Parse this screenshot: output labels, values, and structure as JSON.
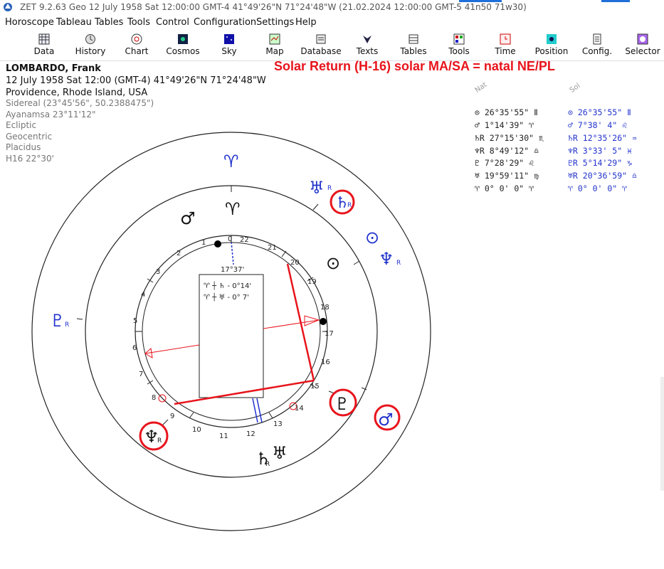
{
  "window": {
    "title": "ZET 9.2.63 Geo   12 July 1958  Sat  12:00:00 GMT-4 41°49'26\"N  71°24'48\"W  (21.02.2024  12:00:00 GMT-5 41n50 71w30)"
  },
  "menu": [
    "Horoscope",
    "Tableau",
    "Tables",
    "Tools",
    "Control",
    "Configuration",
    "Settings",
    "Help"
  ],
  "toolbar": [
    "Data",
    "History",
    "Chart",
    "Cosmos",
    "Sky",
    "Map",
    "Database",
    "Texts",
    "Tables",
    "Tools",
    "Time",
    "Position",
    "Config.",
    "Selector"
  ],
  "header": {
    "name": "LOMBARDO, Frank",
    "datetime": "12 July 1958  Sat  12:00 (GMT-4)  41°49'26\"N  71°24'48\"W",
    "place": "Providence, Rhode Island, USA"
  },
  "calc": {
    "zodiac": "Sidereal (23°45'56\", 50.2388475\")",
    "ayanamsa": "Ayanamsa 23°11'12\"",
    "coords": "Ecliptic",
    "center": "Geocentric",
    "houses": "Placidus",
    "harmonic": "H16  22°30'"
  },
  "chart_label": "Solar Return (H-16) solar MA/SA = natal NE/PL",
  "positions": {
    "natal_header": "Nat",
    "solar_header": "Sol",
    "natal": [
      "⊙   26°35'55\" Ⅱ",
      "♂    1°14'39\" ♈",
      "♄R  27°15'30\" ♏",
      "♆R   8°49'12\" ♎",
      "♇    7°28'29\" ♌",
      "♅   19°59'11\" ♍",
      "♈    0° 0' 0\" ♈"
    ],
    "solar": [
      "⊙   26°35'55\" Ⅱ",
      "♂    7°38' 4\" ♌",
      "♄R  12°35'26\" ♒",
      "♆R   3°33' 5\" ♓",
      "♇R   5°14'29\" ♑",
      "♅R  20°36'59\" ♎",
      "♈    0° 0' 0\" ♈"
    ]
  },
  "chart": {
    "inner_box": {
      "mc_degree": "17°37'",
      "aspect1": "♈ ┼ ♄ - 0°14'",
      "aspect2": "♈ ┼ ♅ - 0° 7'"
    },
    "house_numbers": [
      "22",
      "21",
      "20",
      "19",
      "18",
      "17",
      "16",
      "15",
      "14",
      "13",
      "12",
      "11",
      "10",
      "9",
      "8",
      "7",
      "6",
      "5",
      "4",
      "3",
      "2",
      "1",
      "0"
    ],
    "glyphs": {
      "aries_top": "♈",
      "aries_inner": "♈",
      "mars_natal": "♂",
      "sun_natal": "⊙",
      "pluto_natal": "♇",
      "neptune_natal": "♆",
      "saturn_natal": "♄",
      "uranus_natal": "♅",
      "uranus_solar": "♅",
      "saturn_solar": "♄",
      "sun_solar": "⊙",
      "neptune_solar": "♆",
      "pluto_solar": "♇",
      "mars_solar": "♂",
      "retro": "R"
    }
  },
  "colors": {
    "accent_red": "#e8141c",
    "solar_blue": "#2233cc",
    "ink": "#111111"
  }
}
